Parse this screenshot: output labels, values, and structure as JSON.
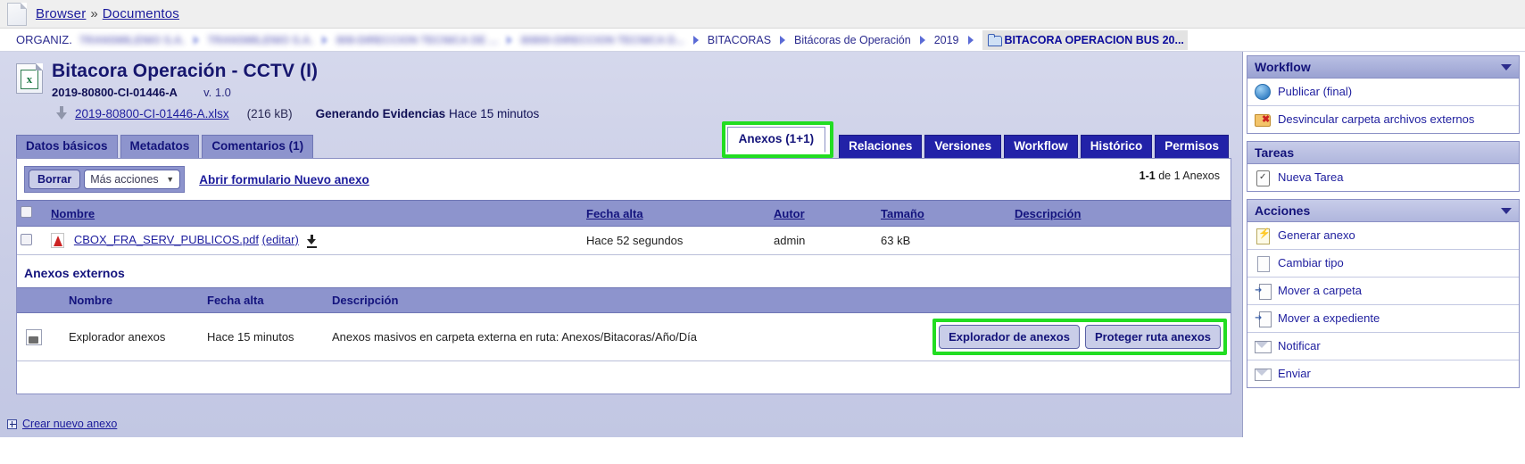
{
  "topbar": {
    "doc_icon": "document-icon",
    "breadcrumb": [
      {
        "label": "Browser",
        "link": true
      },
      {
        "label": "»",
        "link": false
      },
      {
        "label": "Documentos",
        "link": true
      }
    ]
  },
  "orgbar": {
    "label": "ORGANIZ.",
    "redacted": [
      "TRANSMILENIO S.A.",
      "TRANSMILENIO S.A.",
      "808-DIRECCION TECNICA DE ...",
      "80800-DIRECCION TECNICA D..."
    ],
    "path": [
      "BITACORAS",
      "Bitácoras de Operación",
      "2019"
    ],
    "current": "BITACORA OPERACION BUS 20...",
    "current_icon": "folder-icon"
  },
  "document": {
    "icon": "excel-file-icon",
    "title": "Bitacora Operación - CCTV (I)",
    "code": "2019-80800-CI-01446-A",
    "version": "v. 1.0",
    "file_name": "2019-80800-CI-01446-A.xlsx",
    "file_size": "(216 kB)",
    "status": "Generando Evidencias",
    "status_time": "Hace 15 minutos",
    "download_icon": "download-icon"
  },
  "tabs": {
    "left": [
      {
        "label": "Datos básicos"
      },
      {
        "label": "Metadatos"
      },
      {
        "label": "Comentarios (1)"
      }
    ],
    "right": [
      {
        "label": "Anexos (1+1)",
        "active": true,
        "highlighted": true
      },
      {
        "label": "Relaciones",
        "active": false
      },
      {
        "label": "Versiones",
        "active": false
      },
      {
        "label": "Workflow",
        "active": false
      },
      {
        "label": "Histórico",
        "active": false
      },
      {
        "label": "Permisos",
        "active": false
      }
    ]
  },
  "toolbar": {
    "delete_label": "Borrar",
    "more_actions_label": "Más acciones",
    "more_actions_caret": "▼",
    "new_form_link": "Abrir formulario Nuevo anexo",
    "counter_bold": "1-1",
    "counter_rest": "de 1 Anexos"
  },
  "attachments_table": {
    "columns": [
      "Nombre",
      "Fecha alta",
      "Autor",
      "Tamaño",
      "Descripción"
    ],
    "rows": [
      {
        "checkbox": false,
        "file_icon": "pdf-icon",
        "name": "CBOX_FRA_SERV_PUBLICOS.pdf",
        "edit_label": "(editar)",
        "download_icon": "download-icon",
        "date": "Hace 52 segundos",
        "author": "admin",
        "size": "63 kB",
        "description": ""
      }
    ]
  },
  "external": {
    "title": "Anexos externos",
    "columns": [
      "Nombre",
      "Fecha alta",
      "Descripción"
    ],
    "rows": [
      {
        "icon": "external-folder-icon",
        "name": "Explorador anexos",
        "date": "Hace 15 minutos",
        "description": "Anexos masivos en carpeta externa en ruta: Anexos/Bitacoras/Año/Día"
      }
    ],
    "buttons": [
      {
        "label": "Explorador de anexos"
      },
      {
        "label": "Proteger ruta anexos"
      }
    ],
    "buttons_highlighted": true
  },
  "bottom": {
    "expand_icon": "plus-box-icon",
    "link": "Crear nuevo anexo"
  },
  "sidebar": {
    "groups": [
      {
        "title": "Workflow",
        "collapsible": true,
        "items": [
          {
            "label": "Publicar (final)",
            "icon": "globe-icon"
          },
          {
            "label": "Desvincular carpeta archivos externos",
            "icon": "folder-remove-icon"
          }
        ]
      },
      {
        "title": "Tareas",
        "collapsible": false,
        "items": [
          {
            "label": "Nueva Tarea",
            "icon": "clipboard-icon"
          }
        ]
      },
      {
        "title": "Acciones",
        "collapsible": true,
        "items": [
          {
            "label": "Generar anexo",
            "icon": "note-lightning-icon"
          },
          {
            "label": "Cambiar tipo",
            "icon": "page-icon"
          },
          {
            "label": "Mover a carpeta",
            "icon": "move-folder-icon"
          },
          {
            "label": "Mover a expediente",
            "icon": "move-file-icon"
          },
          {
            "label": "Notificar",
            "icon": "mail-icon"
          },
          {
            "label": "Enviar",
            "icon": "mail-icon"
          }
        ]
      }
    ]
  },
  "colors": {
    "accent_blue": "#2222a8",
    "tab_purple": "#8d94cd",
    "highlight_green": "#22dd22",
    "title_navy": "#16166e"
  }
}
